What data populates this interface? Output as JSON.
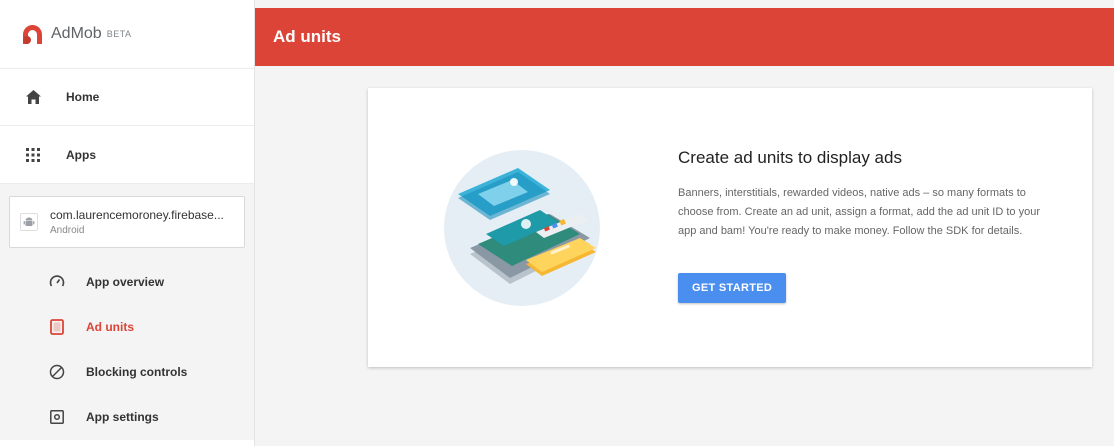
{
  "brand": {
    "name": "AdMob",
    "beta": "BETA"
  },
  "nav": [
    {
      "label": "Home",
      "icon": "home-icon"
    },
    {
      "label": "Apps",
      "icon": "apps-grid-icon"
    }
  ],
  "app": {
    "package": "com.laurencemoroney.firebase...",
    "platform": "Android",
    "icon": "android-icon"
  },
  "sub_nav": [
    {
      "label": "App overview",
      "icon": "gauge-icon",
      "active": false
    },
    {
      "label": "Ad units",
      "icon": "ad-unit-icon",
      "active": true
    },
    {
      "label": "Blocking controls",
      "icon": "block-icon",
      "active": false
    },
    {
      "label": "App settings",
      "icon": "settings-icon",
      "active": false
    }
  ],
  "header": {
    "title": "Ad units"
  },
  "empty_state": {
    "title": "Create ad units to display ads",
    "description": "Banners, interstitials, rewarded videos, native ads – so many formats to choose from. Create an ad unit, assign a format, add the ad unit ID to your app and bam! You're ready to make money. Follow the SDK for details.",
    "button": "GET STARTED"
  },
  "colors": {
    "accent": "#db4437",
    "primary_button": "#4a8ff0"
  }
}
